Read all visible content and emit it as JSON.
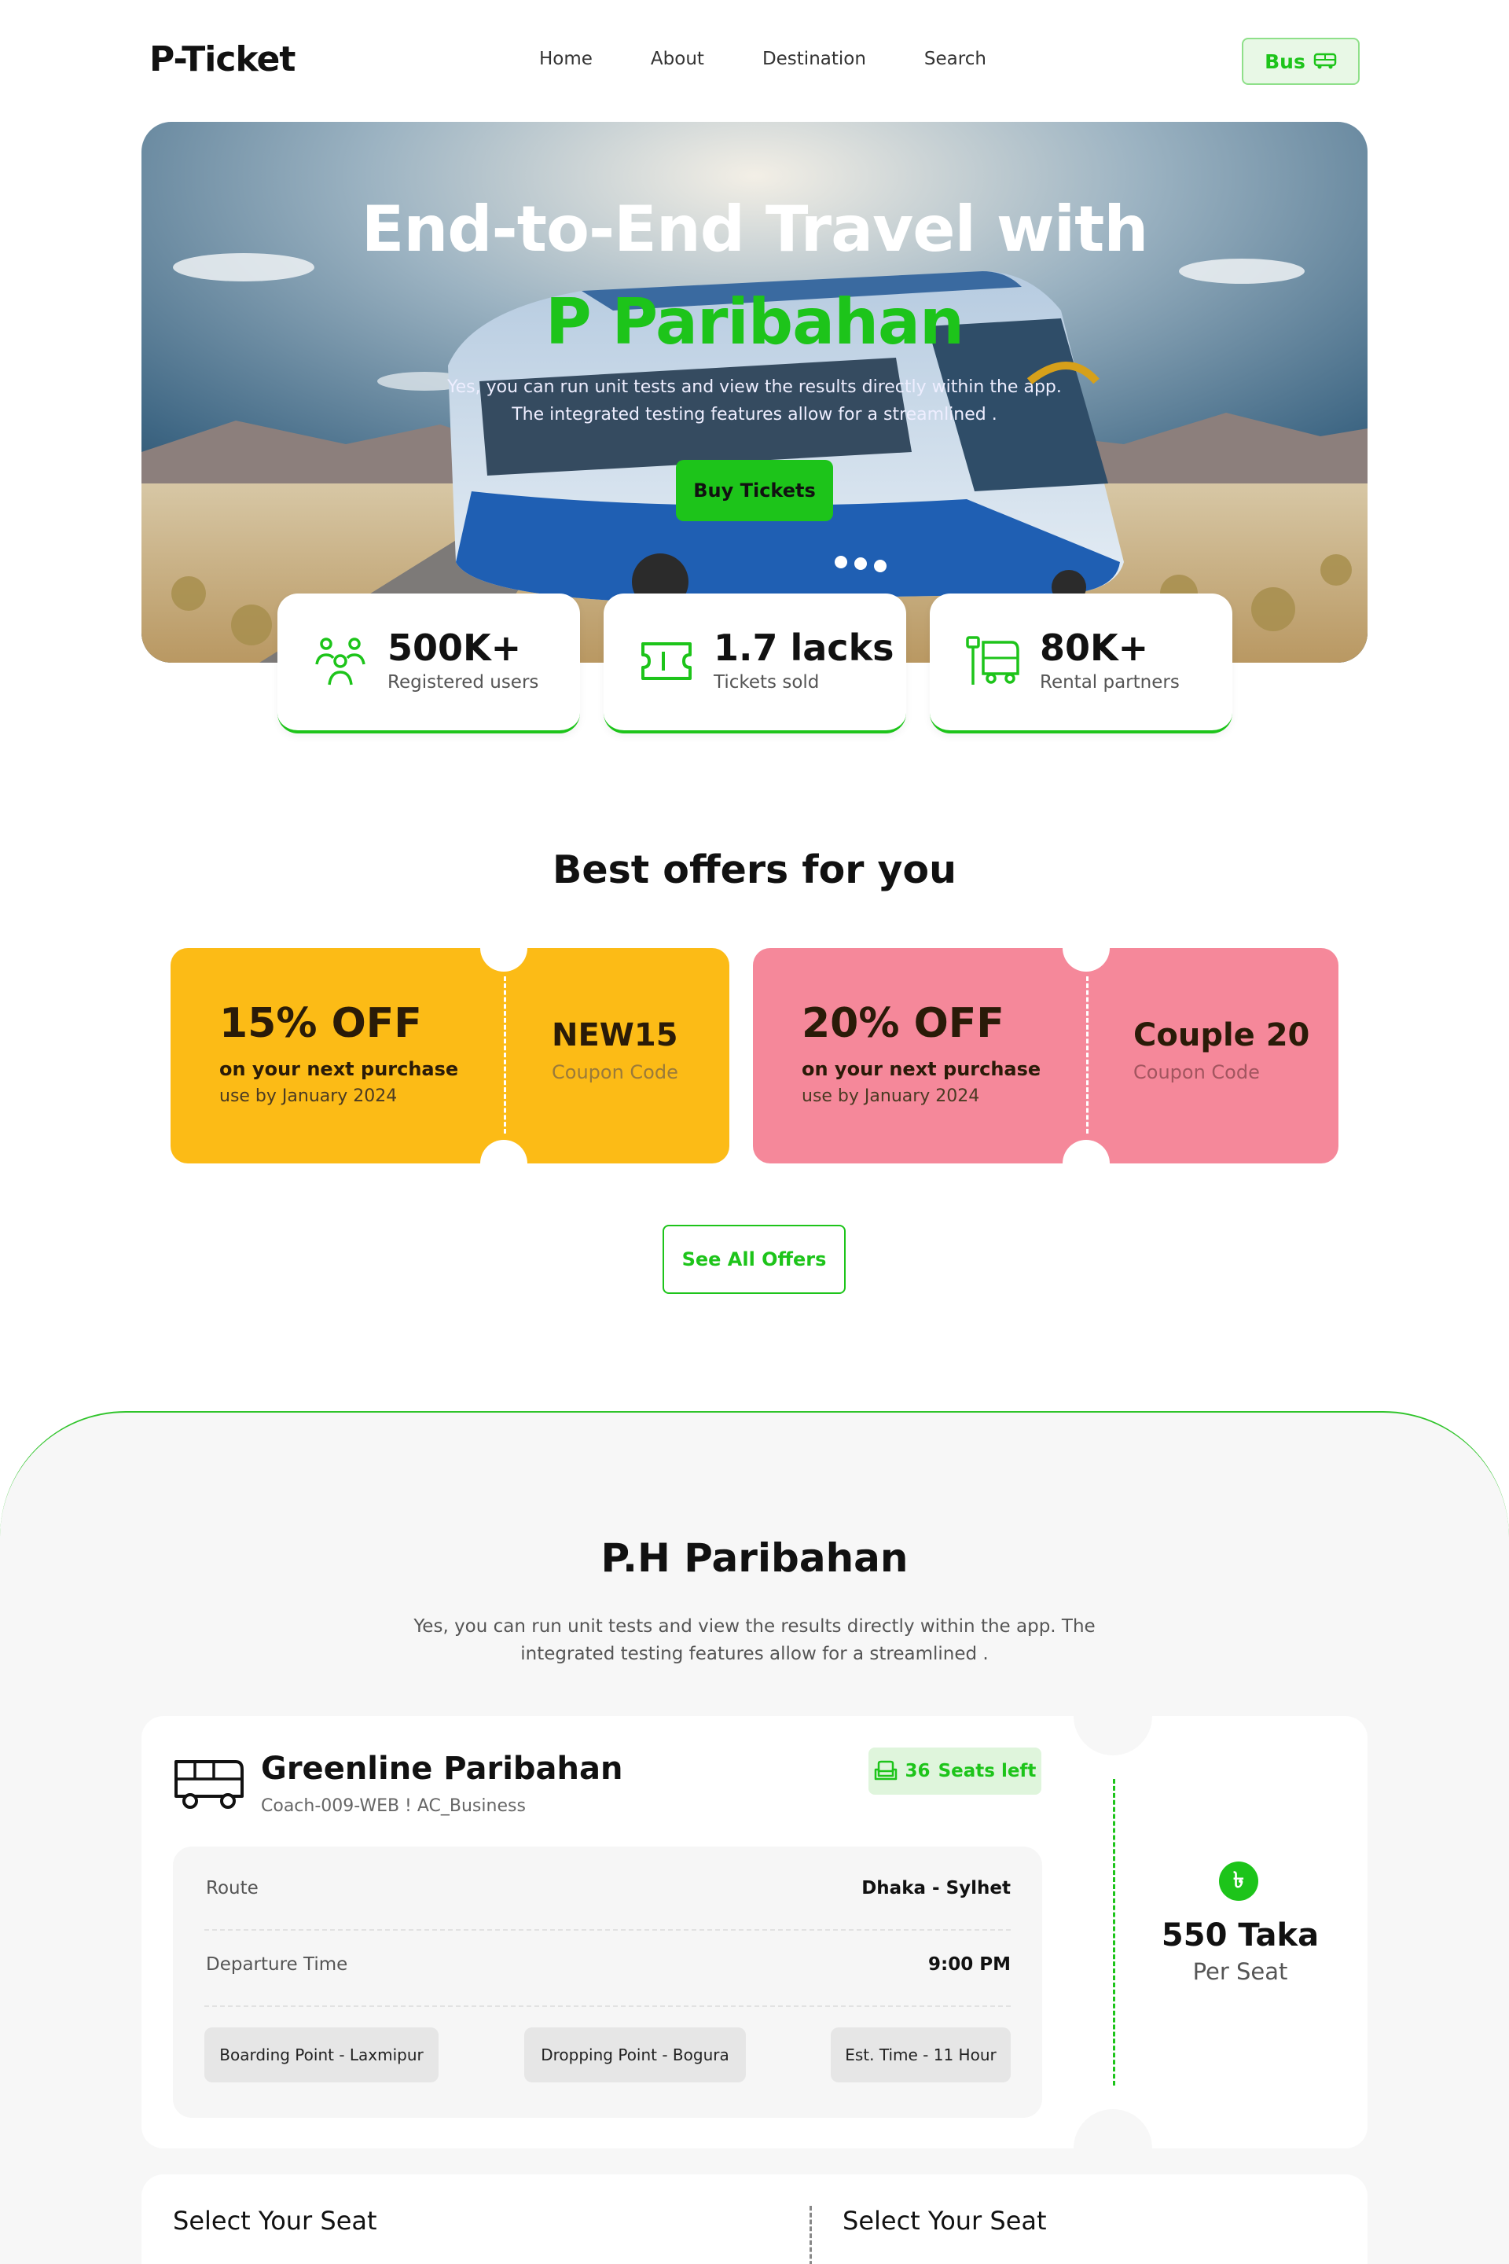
{
  "nav": {
    "logo": "P-Ticket",
    "links": [
      "Home",
      "About",
      "Destination",
      "Search"
    ],
    "bus_button": "Bus"
  },
  "hero": {
    "title_line1": "End-to-End Travel with",
    "title_line2": "P Paribahan",
    "description": "Yes, you can run unit tests and view the results directly within the app. The integrated testing features allow for a streamlined .",
    "buy_button": "Buy Tickets"
  },
  "stats": [
    {
      "icon": "users-icon",
      "value": "500K+",
      "label": "Registered users"
    },
    {
      "icon": "ticket-icon",
      "value": "1.7 lacks",
      "label": "Tickets sold"
    },
    {
      "icon": "bus-stop-icon",
      "value": "80K+",
      "label": "Rental partners"
    }
  ],
  "offers": {
    "title": "Best offers for you",
    "coupons": [
      {
        "discount": "15% OFF",
        "subtitle": "on your next purchase",
        "validity": "use by January 2024",
        "code": "NEW15",
        "code_label": "Coupon Code",
        "color": "#fcbb16"
      },
      {
        "discount": "20% OFF",
        "subtitle": "on your next purchase",
        "validity": "use by January 2024",
        "code": "Couple 20",
        "code_label": "Coupon Code",
        "color": "#f5889a"
      }
    ],
    "see_all_button": "See All Offers"
  },
  "paribahan": {
    "title": "P.H Paribahan",
    "description": "Yes, you can run unit tests and view the results directly within the app. The integrated testing features allow for a streamlined ."
  },
  "bus_card": {
    "name": "Greenline Paribahan",
    "code": "Coach-009-WEB ! AC_Business",
    "seats_count": "36",
    "seats_label": "Seats left",
    "route_label": "Route",
    "route_value": "Dhaka - Sylhet",
    "departure_label": "Departure Time",
    "departure_value": "9:00 PM",
    "boarding": "Boarding Point - Laxmipur",
    "dropping": "Dropping Point - Bogura",
    "est_time": "Est. Time - 11 Hour",
    "currency_symbol": "৳",
    "price": "550 Taka",
    "per": "Per Seat"
  },
  "seat_select": {
    "left_title": "Select Your Seat",
    "right_title": "Select Your Seat"
  },
  "colors": {
    "accent": "#1dc41a",
    "coupon_yellow": "#fcbb16",
    "coupon_pink": "#f5889a"
  }
}
